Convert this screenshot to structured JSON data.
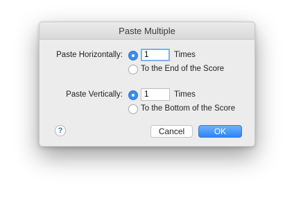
{
  "dialog": {
    "title": "Paste Multiple",
    "horizontal": {
      "label": "Paste Horizontally:",
      "times_value": "1",
      "times_label": "Times",
      "end_option_label": "To the End of the Score",
      "selected": "times"
    },
    "vertical": {
      "label": "Paste Vertically:",
      "times_value": "1",
      "times_label": "Times",
      "bottom_option_label": "To the Bottom of the Score",
      "selected": "times"
    },
    "help_glyph": "?",
    "cancel_label": "Cancel",
    "ok_label": "OK"
  },
  "icons": {
    "help": "help-icon"
  },
  "colors": {
    "accent": "#3b8cf0",
    "dialog_bg": "#ececec"
  }
}
